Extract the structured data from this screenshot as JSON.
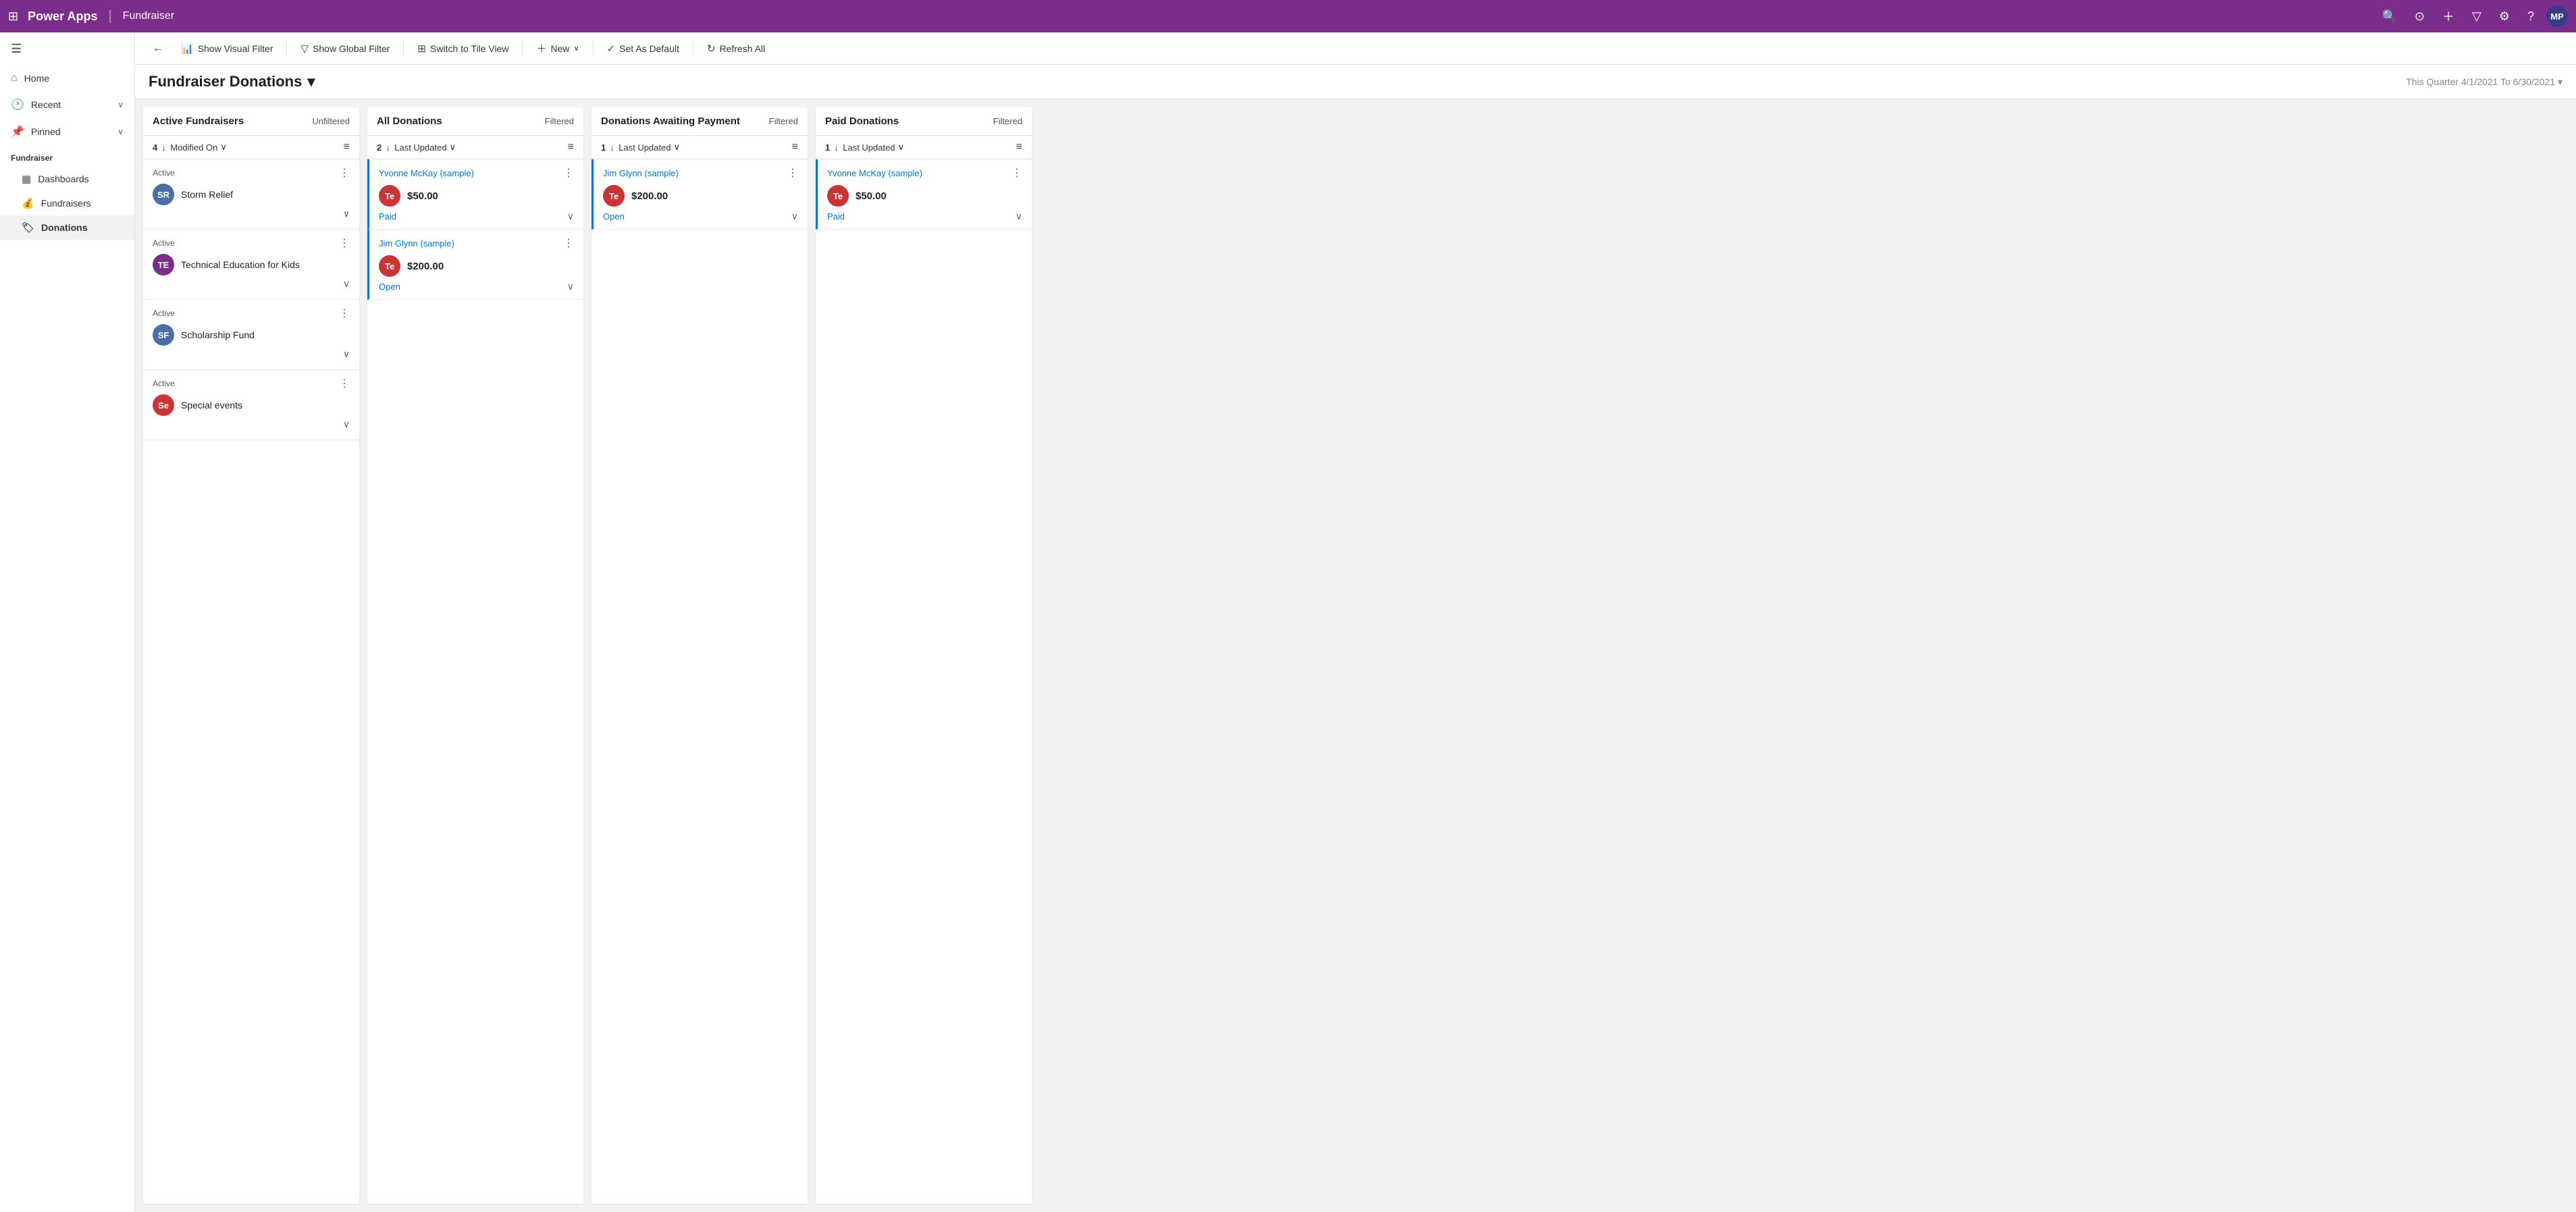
{
  "topNav": {
    "gridIcon": "⊞",
    "brand": "Power Apps",
    "divider": "|",
    "appName": "Fundraiser",
    "icons": [
      "🔍",
      "⊙",
      "+",
      "▽",
      "⚙",
      "?"
    ],
    "avatar": "MP"
  },
  "sidebar": {
    "hamburgerIcon": "☰",
    "navItems": [
      {
        "id": "home",
        "icon": "⌂",
        "label": "Home",
        "hasChevron": false
      },
      {
        "id": "recent",
        "icon": "🕐",
        "label": "Recent",
        "hasChevron": true
      },
      {
        "id": "pinned",
        "icon": "📌",
        "label": "Pinned",
        "hasChevron": true
      }
    ],
    "sectionLabel": "Fundraiser",
    "subItems": [
      {
        "id": "dashboards",
        "icon": "▦",
        "label": "Dashboards"
      },
      {
        "id": "fundraisers",
        "icon": "💰",
        "label": "Fundraisers"
      },
      {
        "id": "donations",
        "icon": "🏷",
        "label": "Donations",
        "active": true
      }
    ]
  },
  "toolbar": {
    "backIcon": "←",
    "buttons": [
      {
        "id": "show-visual-filter",
        "icon": "📊",
        "label": "Show Visual Filter"
      },
      {
        "id": "show-global-filter",
        "icon": "▽",
        "label": "Show Global Filter"
      },
      {
        "id": "switch-tile-view",
        "icon": "⊞",
        "label": "Switch to Tile View"
      },
      {
        "id": "new",
        "icon": "+",
        "label": "New",
        "hasChevron": true
      },
      {
        "id": "set-default",
        "icon": "✓",
        "label": "Set As Default"
      },
      {
        "id": "refresh-all",
        "icon": "↻",
        "label": "Refresh All"
      }
    ]
  },
  "pageHeader": {
    "title": "Fundraiser Donations",
    "chevron": "▾",
    "dateFilter": "This Quarter 4/1/2021 To 6/30/2021",
    "dateChevron": "▾"
  },
  "kanban": {
    "columns": [
      {
        "id": "active-fundraisers",
        "title": "Active Fundraisers",
        "filterLabel": "Unfiltered",
        "count": 4,
        "sortField": "Modified On",
        "cards": [
          {
            "status": "Active",
            "avatarBg": "#4a6fa5",
            "avatarText": "SR",
            "name": "Storm Relief"
          },
          {
            "status": "Active",
            "avatarBg": "#7b2d8b",
            "avatarText": "TE",
            "name": "Technical Education for Kids"
          },
          {
            "status": "Active",
            "avatarBg": "#4a6fa5",
            "avatarText": "SF",
            "name": "Scholarship Fund"
          },
          {
            "status": "Active",
            "avatarBg": "#cc3333",
            "avatarText": "Se",
            "name": "Special events"
          }
        ]
      },
      {
        "id": "all-donations",
        "title": "All Donations",
        "filterLabel": "Filtered",
        "count": 2,
        "sortField": "Last Updated",
        "cards": [
          {
            "personLink": "Yvonne McKay (sample)",
            "avatarBg": "#cc3333",
            "avatarText": "Te",
            "amount": "$50.00",
            "status": "Paid",
            "statusColor": "paid"
          },
          {
            "personLink": "Jim Glynn (sample)",
            "avatarBg": "#cc3333",
            "avatarText": "Te",
            "amount": "$200.00",
            "status": "Open",
            "statusColor": "open"
          }
        ]
      },
      {
        "id": "donations-awaiting",
        "title": "Donations Awaiting Payment",
        "filterLabel": "Filtered",
        "count": 1,
        "sortField": "Last Updated",
        "cards": [
          {
            "personLink": "Jim Glynn (sample)",
            "avatarBg": "#cc3333",
            "avatarText": "Te",
            "amount": "$200.00",
            "status": "Open",
            "statusColor": "open"
          }
        ]
      },
      {
        "id": "paid-donations",
        "title": "Paid Donations",
        "filterLabel": "Filtered",
        "count": 1,
        "sortField": "Last Updated",
        "cards": [
          {
            "personLink": "Yvonne McKay (sample)",
            "avatarBg": "#cc3333",
            "avatarText": "Te",
            "amount": "$50.00",
            "status": "Paid",
            "statusColor": "paid"
          }
        ]
      }
    ]
  }
}
